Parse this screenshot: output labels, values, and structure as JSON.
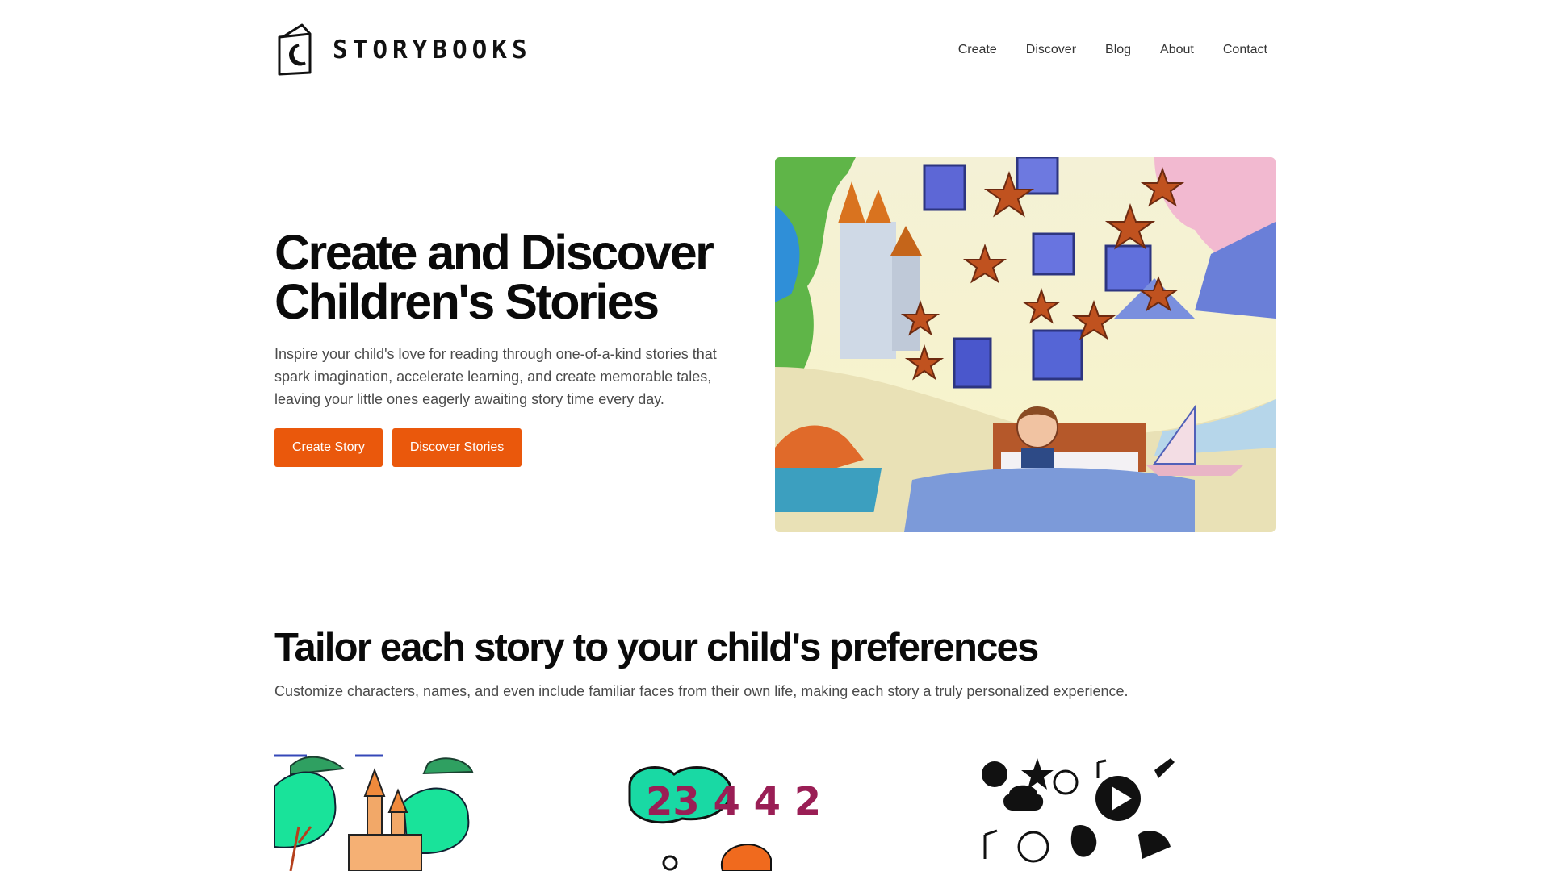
{
  "brand": {
    "name": "STORYBOOKS",
    "icon": "moon-book-icon"
  },
  "nav": [
    "Create",
    "Discover",
    "Blog",
    "About",
    "Contact"
  ],
  "hero": {
    "title_line1": "Create and Discover",
    "title_line2": "Children's Stories",
    "subtitle": "Inspire your child's love for reading through one-of-a-kind stories that spark imagination, accelerate learning, and create memorable tales, leaving your little ones eagerly awaiting story time every day.",
    "primary_button": "Create Story",
    "secondary_button": "Discover Stories"
  },
  "section": {
    "title": "Tailor each story to your child's preferences",
    "subtitle": "Customize characters, names, and even include familiar faces from their own life, making each story a truly personalized experience."
  },
  "feature_images": [
    "castle-illustration",
    "numbers-illustration",
    "doodles-illustration"
  ],
  "feature_numbers": {
    "text": "23 4 4 2"
  },
  "colors": {
    "accent": "#ea580c",
    "text": "#0a0a0a",
    "muted": "#4b4b4b"
  }
}
